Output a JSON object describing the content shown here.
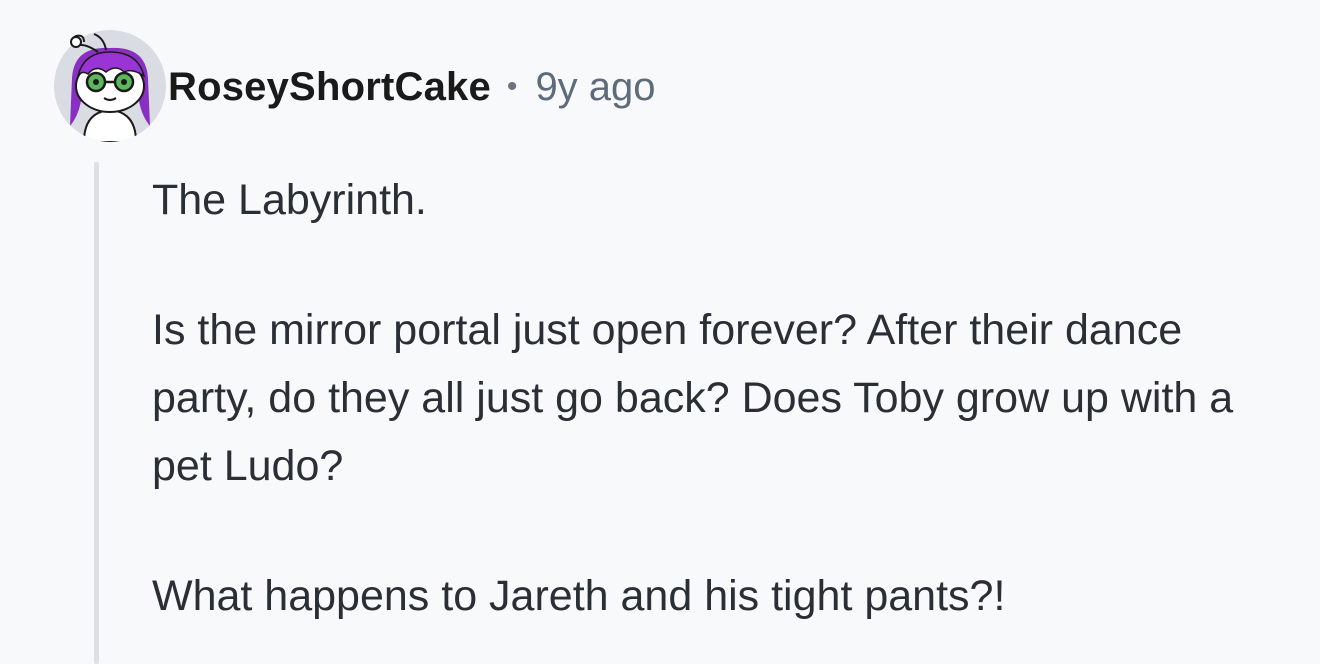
{
  "comment": {
    "author": "RoseyShortCake",
    "separator": "•",
    "timestamp": "9y ago",
    "avatar_icon": "snoo-avatar-icon",
    "paragraphs": [
      "The Labyrinth.",
      "Is the mirror portal just open forever? After their dance party, do they all just go back? Does Toby grow up with a pet Ludo?",
      "What happens to Jareth and his tight pants?!"
    ]
  }
}
